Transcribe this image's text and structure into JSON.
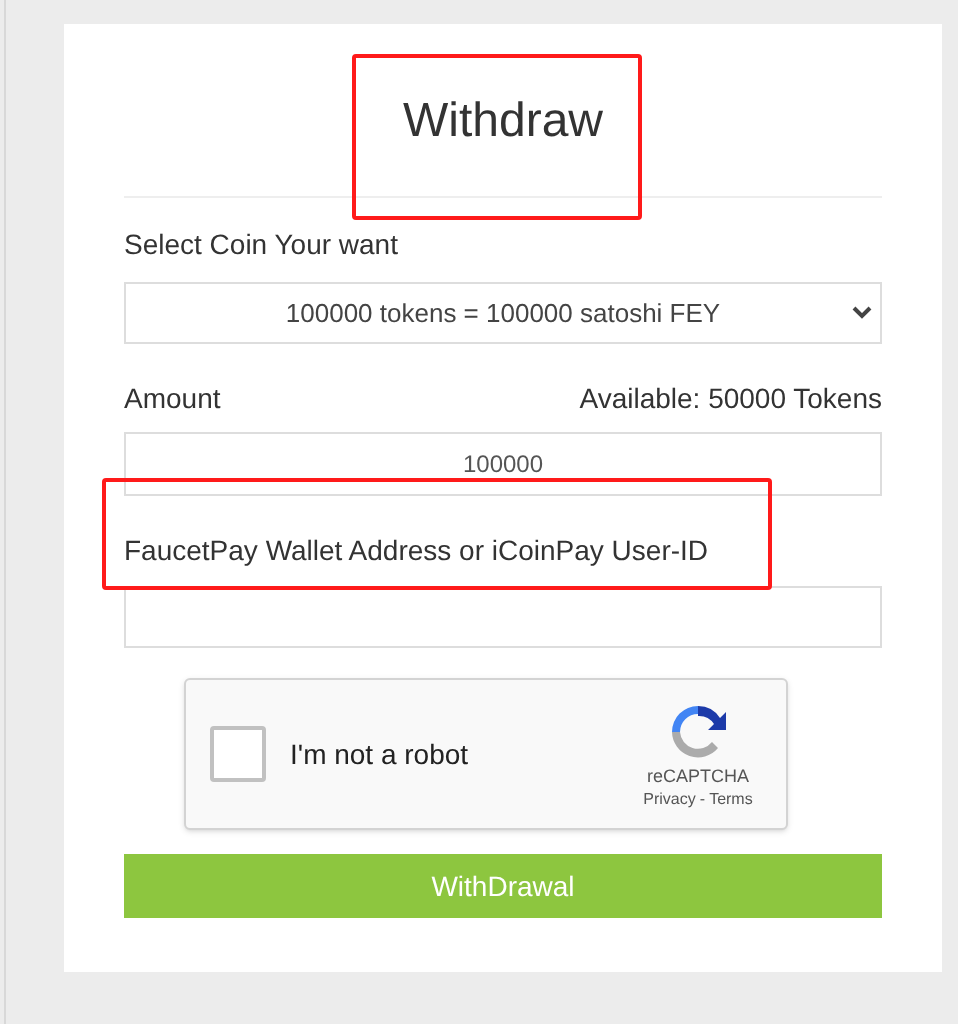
{
  "title": "Withdraw",
  "coin_select": {
    "label": "Select Coin Your want",
    "value": "100000 tokens = 100000 satoshi FEY"
  },
  "amount": {
    "label": "Amount",
    "available": "Available: 50000 Tokens",
    "value": "100000"
  },
  "wallet": {
    "label": "FaucetPay Wallet Address or iCoinPay User-ID"
  },
  "captcha": {
    "label": "I'm not a robot",
    "checked": false,
    "brand": "reCAPTCHA",
    "privacy": "Privacy",
    "separator": "-",
    "terms": "Terms"
  },
  "submit": "WithDrawal"
}
